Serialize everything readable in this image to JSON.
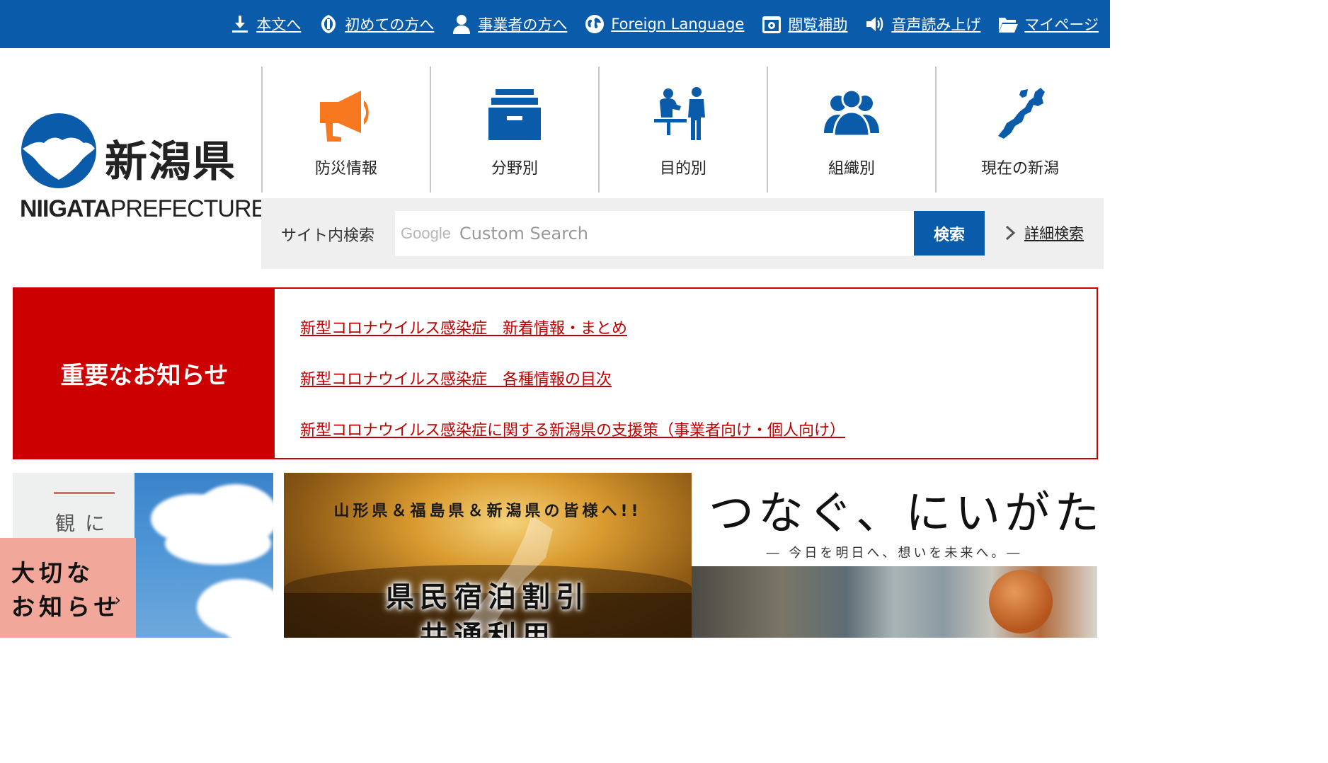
{
  "topbar": {
    "links": [
      {
        "label": "本文へ",
        "icon": "download-arrow-icon"
      },
      {
        "label": "初めての方へ",
        "icon": "leaf-badge-icon"
      },
      {
        "label": "事業者の方へ",
        "icon": "person-icon"
      },
      {
        "label": "Foreign Language",
        "icon": "globe-icon"
      },
      {
        "label": "閲覧補助",
        "icon": "accessibility-gear-icon"
      },
      {
        "label": "音声読み上げ",
        "icon": "speaker-icon"
      },
      {
        "label": "マイページ",
        "icon": "folder-icon"
      }
    ]
  },
  "logo": {
    "kanji": "新潟県",
    "en_bold": "NIIGATA",
    "en_light": "PREFECTURE"
  },
  "mainnav": {
    "items": [
      {
        "label": "防災情報",
        "icon": "megaphone-icon",
        "color": "#f7781e"
      },
      {
        "label": "分野別",
        "icon": "file-box-icon",
        "color": "#0a5cab"
      },
      {
        "label": "目的別",
        "icon": "counter-service-icon",
        "color": "#0a5cab"
      },
      {
        "label": "組織別",
        "icon": "group-icon",
        "color": "#0a5cab"
      },
      {
        "label": "現在の新潟",
        "icon": "niigata-map-icon",
        "color": "#0a5cab"
      }
    ]
  },
  "search": {
    "label": "サイト内検索",
    "google_label": "Google",
    "placeholder": "Custom Search",
    "button": "検索",
    "advanced": "詳細検索"
  },
  "notice": {
    "heading": "重要なお知らせ",
    "links": [
      "新型コロナウイルス感染症　新着情報・まとめ",
      "新型コロナウイルス感染症　各種情報の目次",
      "新型コロナウイルス感染症に関する新潟県の支援策（事業者向け・個人向け）"
    ]
  },
  "banners": {
    "b1_text": "観に",
    "b2_header": "山形県＆福島県＆新潟県の皆様へ!!",
    "b2_title1": "県民宿泊割引",
    "b2_title2": "共通利用",
    "b3_title": "つなぐ、にいがた。",
    "b3_sub": "― 今日を明日へ、想いを未来へ。―"
  },
  "floating_tab": {
    "line1": "大切な",
    "line2": "お知らせ",
    "chevron": "›"
  },
  "colors": {
    "brand_blue": "#0a5cab",
    "alert_red": "#cc0000",
    "notice_tab": "#f2a79b",
    "disaster_orange": "#f7781e"
  }
}
